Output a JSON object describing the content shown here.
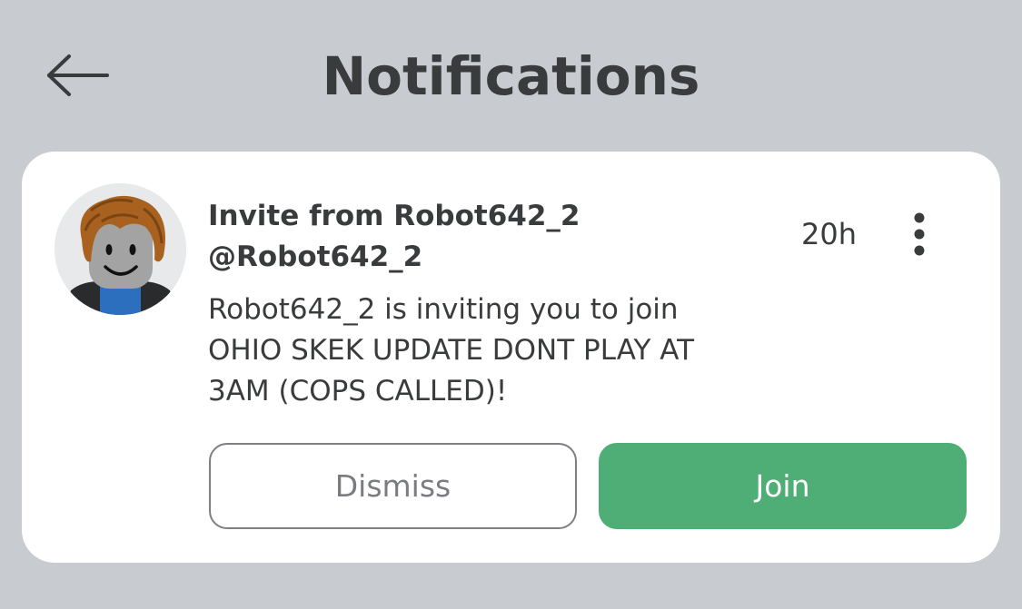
{
  "header": {
    "title": "Notifications",
    "back_icon": "arrow-left-icon"
  },
  "notification": {
    "avatar_icon": "avatar-image",
    "title_line1": "Invite from Robot642_2",
    "title_line2": "@Robot642_2",
    "timestamp": "20h",
    "more_icon": "more-vertical-icon",
    "message_lines": [
      "Robot642_2 is inviting you to join",
      "OHIO SKEK UPDATE DONT PLAY AT",
      "3AM (COPS CALLED)!"
    ],
    "dismiss_label": "Dismiss",
    "join_label": "Join"
  },
  "colors": {
    "background": "#c8cbd0",
    "card": "#ffffff",
    "text": "#393b3d",
    "join_button": "#4fad76",
    "dismiss_border": "#7d7f82"
  }
}
